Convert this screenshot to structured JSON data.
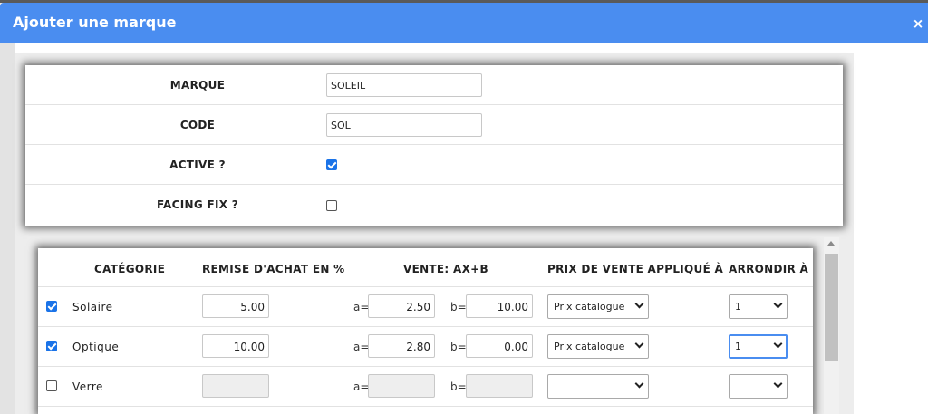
{
  "dialog": {
    "title": "Ajouter une marque",
    "close_icon": "×"
  },
  "form": {
    "marque_label": "MARQUE",
    "marque_value": "SOLEIL",
    "code_label": "CODE",
    "code_value": "SOL",
    "active_label": "ACTIVE ?",
    "active_checked": true,
    "facing_label": "FACING FIX ?",
    "facing_checked": false
  },
  "table": {
    "headers": {
      "categorie": "CATÉGORIE",
      "remise": "REMISE D'ACHAT EN %",
      "vente": "VENTE: AX+B",
      "prix": "PRIX DE VENTE APPLIQUÉ À",
      "arrondir": "ARRONDIR À"
    },
    "prefix_a": "a=",
    "prefix_b": "b=",
    "rows": [
      {
        "checked": true,
        "name": "Solaire",
        "remise": "5.00",
        "a": "2.50",
        "b": "10.00",
        "prix": "Prix catalogue",
        "arrondir": "1"
      },
      {
        "checked": true,
        "name": "Optique",
        "remise": "10.00",
        "a": "2.80",
        "b": "0.00",
        "prix": "Prix catalogue",
        "arrondir": "1"
      },
      {
        "checked": false,
        "name": "Verre",
        "remise": "",
        "a": "",
        "b": "",
        "prix": "",
        "arrondir": ""
      }
    ]
  },
  "colors": {
    "header": "#4a8df0",
    "checkbox": "#1a73e8"
  }
}
